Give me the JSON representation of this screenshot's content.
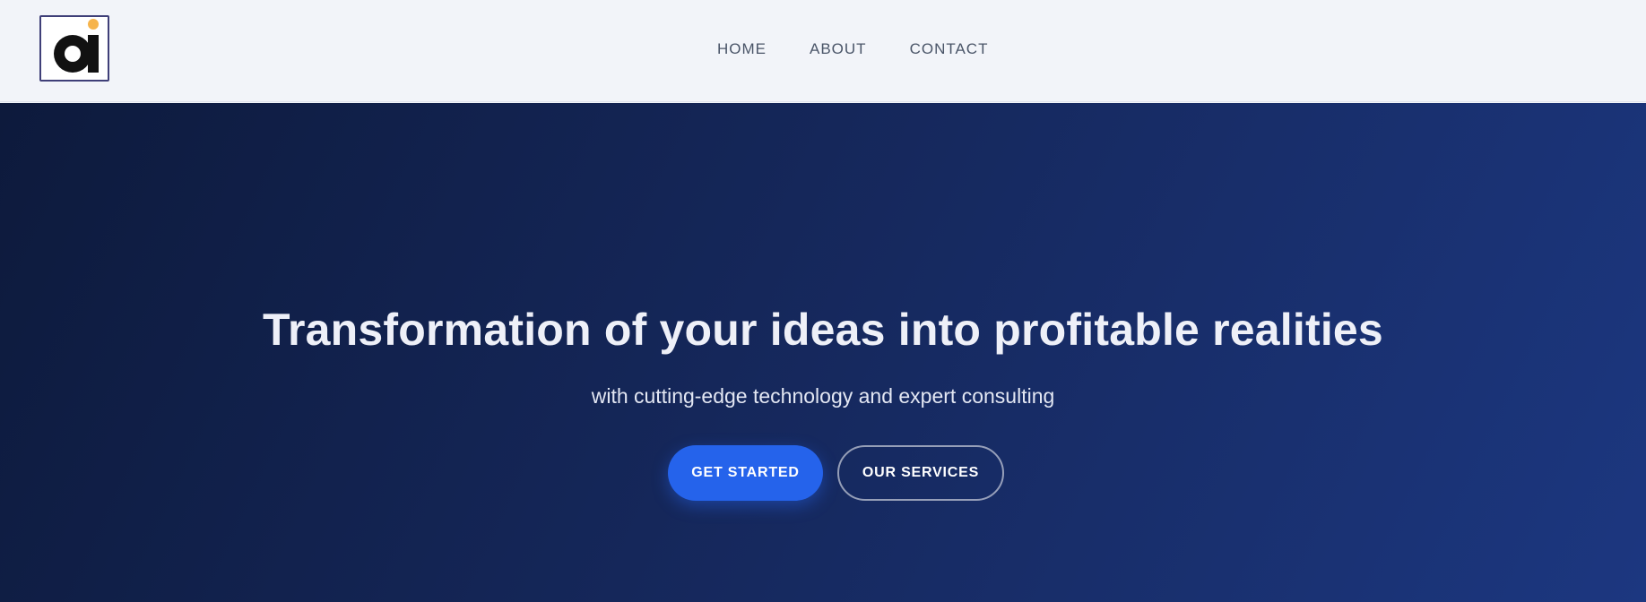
{
  "header": {
    "logo": {
      "icon": "ai-logo-icon",
      "letter_color": "#111111",
      "dot_color": "#f6b44c",
      "border_color": "#3f3f78"
    },
    "nav": [
      {
        "label": "HOME"
      },
      {
        "label": "ABOUT"
      },
      {
        "label": "CONTACT"
      }
    ]
  },
  "hero": {
    "title": "Transformation of your ideas into profitable realities",
    "subtitle": "with cutting-edge technology and expert consulting",
    "primary_button": "GET STARTED",
    "secondary_button": "OUR SERVICES"
  },
  "colors": {
    "header_bg": "#f2f4f9",
    "hero_gradient_start": "#0d1a3c",
    "hero_gradient_end": "#1c3780",
    "accent": "#2563eb",
    "nav_text": "#4a5568"
  }
}
